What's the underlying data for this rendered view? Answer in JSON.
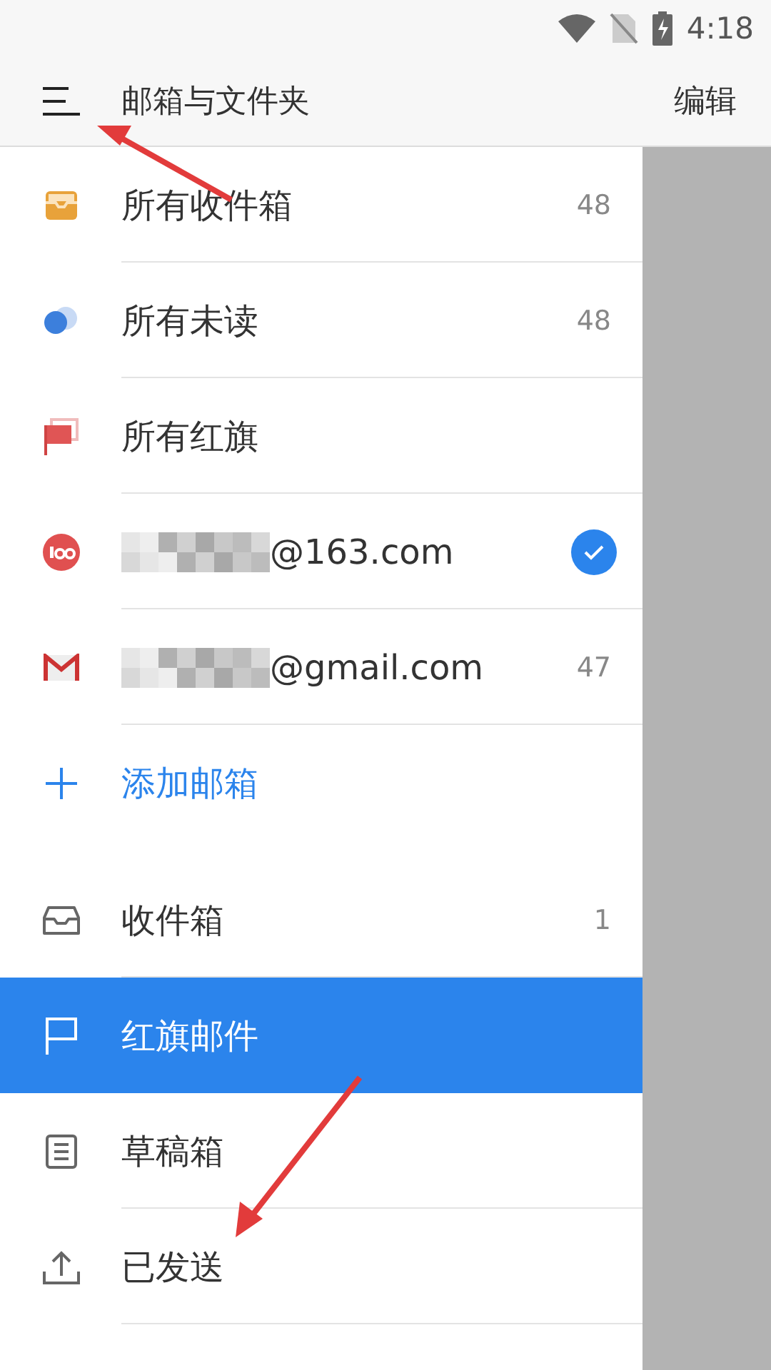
{
  "status_bar": {
    "time": "4:18"
  },
  "header": {
    "title": "邮箱与文件夹",
    "action": "编辑"
  },
  "accounts": [
    {
      "kind": "all-inbox",
      "label": "所有收件箱",
      "count": "48",
      "current": false,
      "masked": false
    },
    {
      "kind": "all-unread",
      "label": "所有未读",
      "count": "48",
      "current": false,
      "masked": false
    },
    {
      "kind": "all-flagged",
      "label": "所有红旗",
      "current": false,
      "masked": false
    },
    {
      "kind": "netease",
      "label": "@163.com",
      "current": true,
      "masked": true
    },
    {
      "kind": "gmail",
      "label": "@gmail.com",
      "count": "47",
      "current": false,
      "masked": true
    }
  ],
  "add_account": {
    "label": "添加邮箱"
  },
  "folders": [
    {
      "kind": "inbox",
      "label": "收件箱",
      "count": "1",
      "selected": false
    },
    {
      "kind": "flagged",
      "label": "红旗邮件",
      "selected": true
    },
    {
      "kind": "drafts",
      "label": "草稿箱",
      "selected": false
    },
    {
      "kind": "sent",
      "label": "已发送",
      "selected": false
    }
  ]
}
